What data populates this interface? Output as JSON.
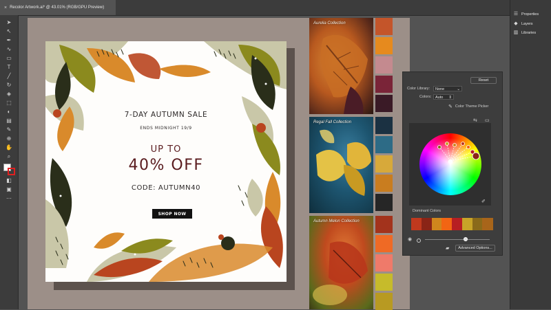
{
  "document_tab": {
    "close": "×",
    "title": "Recolor Artwork.ai* @ 43.01% (RGB/GPU Preview)"
  },
  "right_panel": {
    "items": [
      {
        "label": "Properties",
        "icon": "properties-icon"
      },
      {
        "label": "Layers",
        "icon": "layers-icon"
      },
      {
        "label": "Libraries",
        "icon": "libraries-icon"
      }
    ]
  },
  "artboard": {
    "headline": "7-DAY AUTUMN SALE",
    "subline": "ENDS MIDNIGHT 19/9",
    "up_to": "UP TO",
    "discount": "40% OFF",
    "code": "CODE: AUTUMN40",
    "cta": "SHOP NOW",
    "colors": {
      "dark": "#2a2e1a",
      "olive": "#8b8a1e",
      "orange": "#d98a2b",
      "rust": "#b9451f",
      "sage": "#c9c7a8",
      "text_red": "#5a1c1f"
    }
  },
  "collections": [
    {
      "caption": "Aurelia Collection",
      "swatches": [
        "#c4552a",
        "#e68a1e",
        "#c48a8f",
        "#7a2438",
        "#3a1a26"
      ]
    },
    {
      "caption": "Regal Fall Collection",
      "swatches": [
        "#1b3142",
        "#2d6b86",
        "#d7a93a",
        "#c97d1f",
        "#262626"
      ]
    },
    {
      "caption": "Autumn Melon Collection",
      "swatches": [
        "#a3331c",
        "#ef6a25",
        "#ef7a6a",
        "#c6bb2b",
        "#b89a22"
      ]
    }
  ],
  "recolor": {
    "reset": "Reset",
    "color_library_label": "Color Library:",
    "color_library_value": "None",
    "colors_label": "Colors:",
    "colors_value": "Auto",
    "color_theme_picker": "Color Theme Picker",
    "dominant_colors_label": "Dominant Colors",
    "dominant_colors": [
      "#c0391e",
      "#8a2416",
      "#d0861d",
      "#f26513",
      "#b71f22",
      "#c8a428",
      "#8a6a1a",
      "#a8651a"
    ],
    "advanced_options": "Advanced Options..."
  }
}
